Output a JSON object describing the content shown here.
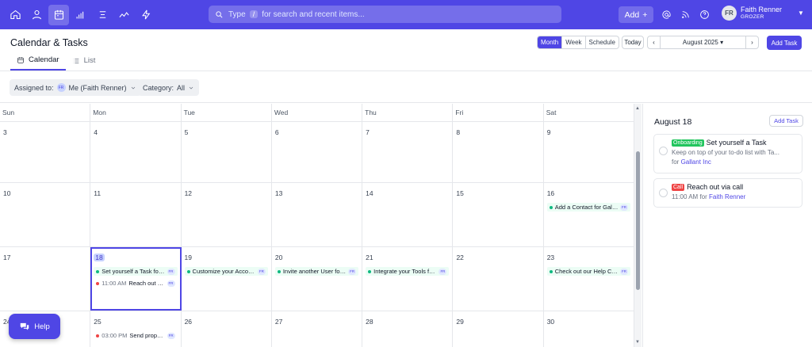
{
  "topbar": {
    "nav_icons": [
      "home-icon",
      "contacts-icon",
      "calendar-icon",
      "reports-icon",
      "list-icon",
      "analytics-icon",
      "automation-icon"
    ],
    "search_prefix": "Type",
    "search_key": "/",
    "search_suffix": "for search and recent items...",
    "add_label": "Add",
    "user_initials": "FR",
    "user_name": "Faith Renner",
    "company": "GROZER"
  },
  "page": {
    "title": "Calendar & Tasks",
    "tabs": [
      {
        "label": "Calendar"
      },
      {
        "label": "List"
      }
    ],
    "views": [
      "Month",
      "Week",
      "Schedule"
    ],
    "active_view": "Month",
    "today_label": "Today",
    "month_label": "August 2025",
    "add_task_label": "Add Task"
  },
  "filters": {
    "assigned_label": "Assigned to:",
    "assigned_initials": "FR",
    "assigned_value": "Me (Faith Renner)",
    "category_label": "Category:",
    "category_value": "All"
  },
  "calendar": {
    "days": [
      "Sun",
      "Mon",
      "Tue",
      "Wed",
      "Thu",
      "Fri",
      "Sat"
    ],
    "weeks": [
      [
        "3",
        "4",
        "5",
        "6",
        "7",
        "8",
        "9"
      ],
      [
        "10",
        "11",
        "12",
        "13",
        "14",
        "15",
        "16"
      ],
      [
        "17",
        "18",
        "19",
        "20",
        "21",
        "22",
        "23"
      ],
      [
        "24",
        "25",
        "26",
        "27",
        "28",
        "29",
        "30"
      ]
    ],
    "events": {
      "sat16": "Add a Contact for Galla...",
      "mon18_a": "Set yourself a Task for ...",
      "mon18_b_time": "11:00 AM",
      "mon18_b": "Reach out via ...",
      "tue19": "Customize your Accoun...",
      "wed20": "Invite another User for ...",
      "thu21": "Integrate your Tools for ...",
      "sat23": "Check out our Help Cen...",
      "mon25_time": "03:00 PM",
      "mon25": "Send propos...",
      "initials": "FR"
    }
  },
  "sidebar": {
    "date": "August 18",
    "add_task_label": "Add Task",
    "tasks": [
      {
        "badge": "Onboarding",
        "badge_color": "#22c55e",
        "title": "Set yourself a Task",
        "desc": "Keep on top of your to-do list with Ta...",
        "for_label": "for",
        "link": "Gallant Inc"
      },
      {
        "badge": "Call",
        "badge_color": "#ef4444",
        "title": "Reach out via call",
        "time": "11:00 AM",
        "for_label": "for",
        "link": "Faith Renner"
      }
    ]
  },
  "help": {
    "label": "Help"
  }
}
